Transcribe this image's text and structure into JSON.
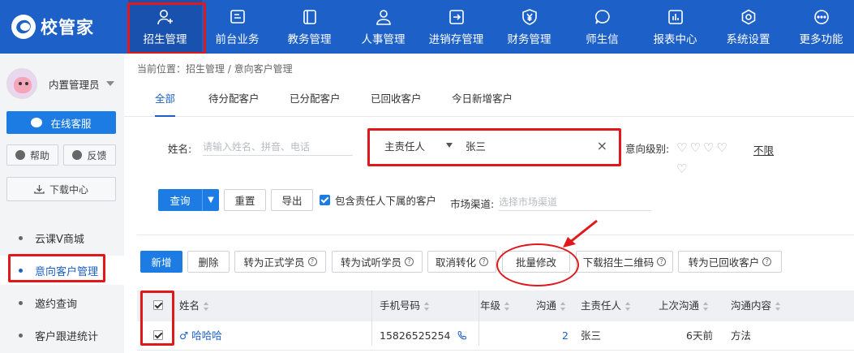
{
  "app": {
    "name": "校管家"
  },
  "nav": {
    "items": [
      {
        "label": "招生管理",
        "icon": "user-plus-icon"
      },
      {
        "label": "前台业务",
        "icon": "monitor-icon"
      },
      {
        "label": "教务管理",
        "icon": "book-icon"
      },
      {
        "label": "人事管理",
        "icon": "person-icon"
      },
      {
        "label": "进销存管理",
        "icon": "login-box-icon"
      },
      {
        "label": "财务管理",
        "icon": "yen-shield-icon"
      },
      {
        "label": "师生信",
        "icon": "chat-icon"
      },
      {
        "label": "报表中心",
        "icon": "bar-chart-icon"
      },
      {
        "label": "系统设置",
        "icon": "gear-icon"
      },
      {
        "label": "更多功能",
        "icon": "more-icon"
      }
    ],
    "active": "招生管理"
  },
  "sidebar": {
    "user_name": "内置管理员",
    "service_label": "在线客服",
    "help_label": "帮助",
    "feedback_label": "反馈",
    "download_label": "下载中心",
    "links": [
      {
        "label": "云课V商城"
      },
      {
        "label": "意向客户管理"
      },
      {
        "label": "邀约查询"
      },
      {
        "label": "客户跟进统计"
      }
    ],
    "active_link": "意向客户管理"
  },
  "breadcrumb": "当前位置：招生管理 / 意向客户管理",
  "tabs": [
    {
      "label": "全部"
    },
    {
      "label": "待分配客户"
    },
    {
      "label": "已分配客户"
    },
    {
      "label": "已回收客户"
    },
    {
      "label": "今日新增客户"
    }
  ],
  "active_tab": "全部",
  "filters": {
    "name_label": "姓名:",
    "name_placeholder": "请输入姓名、拼音、电话",
    "owner_field_label": "主责任人",
    "owner_value": "张三",
    "clear_icon": "×",
    "intent_label": "意向级别:",
    "intent_hearts": "♡♡♡♡",
    "intent_heart_extra": "♡",
    "unlimited_label": "不限",
    "query_label": "查询",
    "reset_label": "重置",
    "export_label": "导出",
    "include_sub_label": "包含责任人下属的客户",
    "include_sub_checked": true,
    "channel_label": "市场渠道:",
    "channel_placeholder": "选择市场渠道"
  },
  "actions": [
    {
      "label": "新增",
      "help": false
    },
    {
      "label": "删除",
      "help": false
    },
    {
      "label": "转为正式学员",
      "help": true
    },
    {
      "label": "转为试听学员",
      "help": true
    },
    {
      "label": "取消转化",
      "help": true
    },
    {
      "label": "批量修改",
      "help": false
    },
    {
      "label": "下载招生二维码",
      "help": true
    },
    {
      "label": "转为已回收客户",
      "help": true
    }
  ],
  "table": {
    "columns": [
      "姓名",
      "手机号码",
      "年级",
      "沟通",
      "主责任人",
      "上次沟通",
      "沟通内容"
    ],
    "header_checked": true,
    "rows": [
      {
        "checked": true,
        "gender": "♂",
        "name": "哈哈哈",
        "phone": "15826525254",
        "grade": "",
        "communications": "2",
        "owner": "张三",
        "last_contact": "6天前",
        "content": "方法"
      }
    ]
  },
  "colors": {
    "topbar": "#1c60c8",
    "accent": "#1c7ce3",
    "highlight": "#e0181b"
  }
}
